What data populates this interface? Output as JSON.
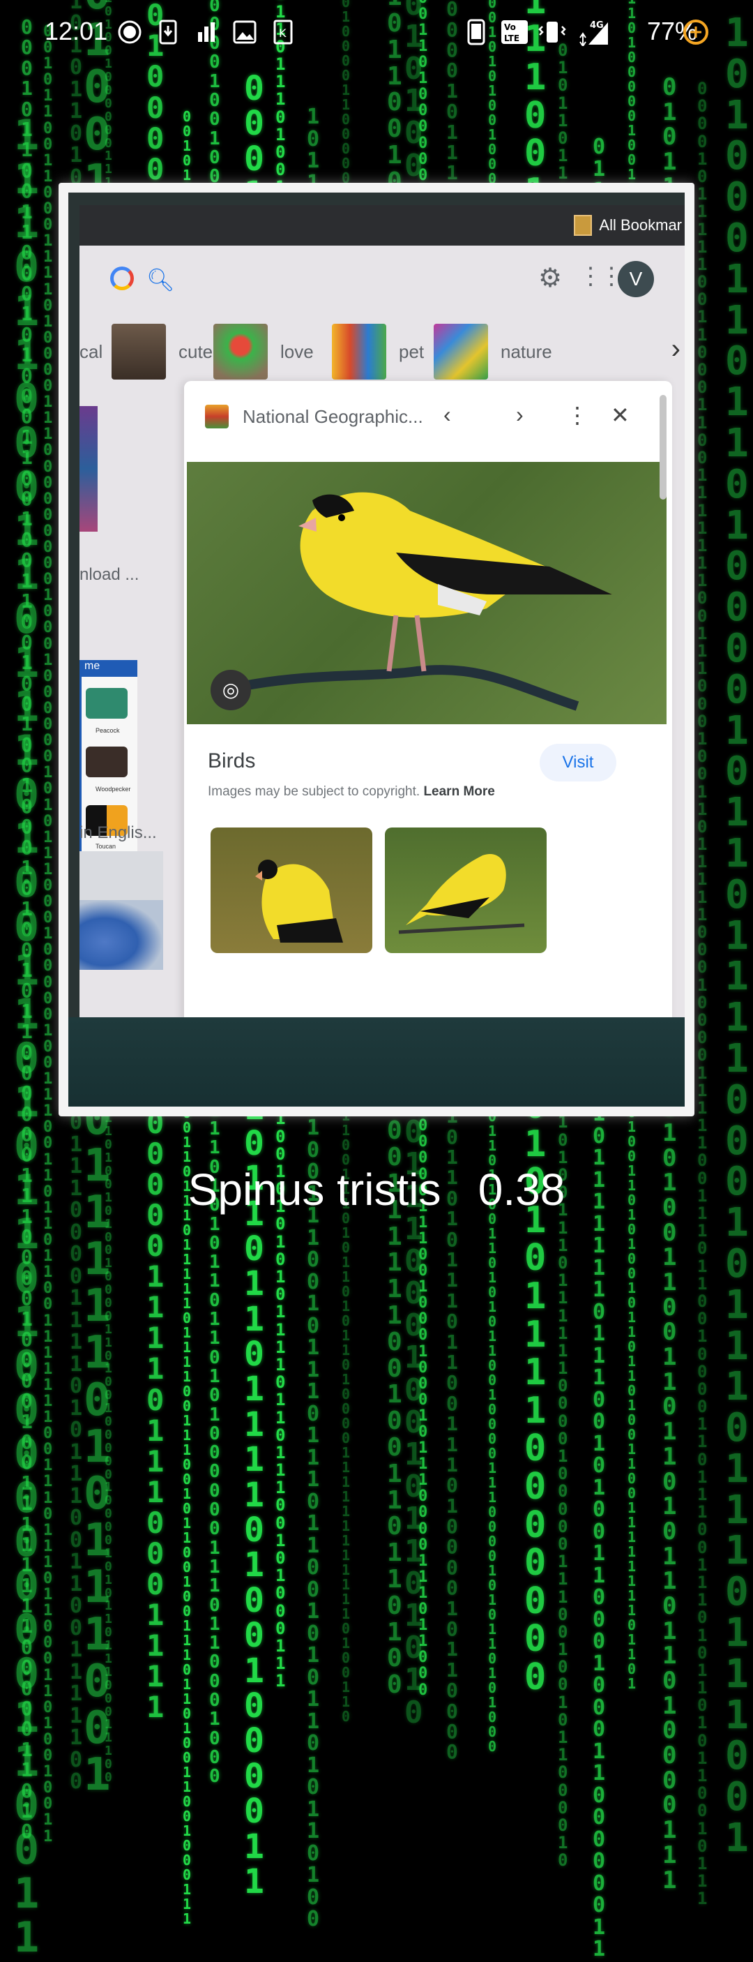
{
  "status_bar": {
    "time": "12:01",
    "battery_percent": "77%",
    "network": "4G",
    "icons": [
      "record-icon",
      "download-icon",
      "signal-bars-icon",
      "gallery-icon",
      "k-app-icon",
      "phone-icon",
      "volte-icon",
      "vibrate-icon",
      "data-signal-icon",
      "battery-saver-icon"
    ]
  },
  "photo": {
    "browser": {
      "bookmarks_label": "All Bookmar"
    },
    "google": {
      "chips": [
        "cal",
        "cute",
        "love",
        "pet",
        "nature"
      ],
      "avatar_letter": "V"
    },
    "sidebar": {
      "label_download": "nload ...",
      "ad_header": "me",
      "ad_captions": [
        "Peacock",
        "Woodpecker",
        "Toucan"
      ],
      "label_english": "in Englis..."
    },
    "panel": {
      "source": "National Geographic...",
      "image_title": "Birds",
      "visit_label": "Visit",
      "copyright_text": "Images may be subject to copyright.",
      "learn_more": "Learn More"
    }
  },
  "result": {
    "species": "Spinus tristis",
    "confidence": "0.38"
  },
  "colors": {
    "matrix_green": "#23e04a",
    "background": "#000000",
    "result_text": "#ffffff",
    "goldfinch_yellow": "#f2dc2a"
  }
}
